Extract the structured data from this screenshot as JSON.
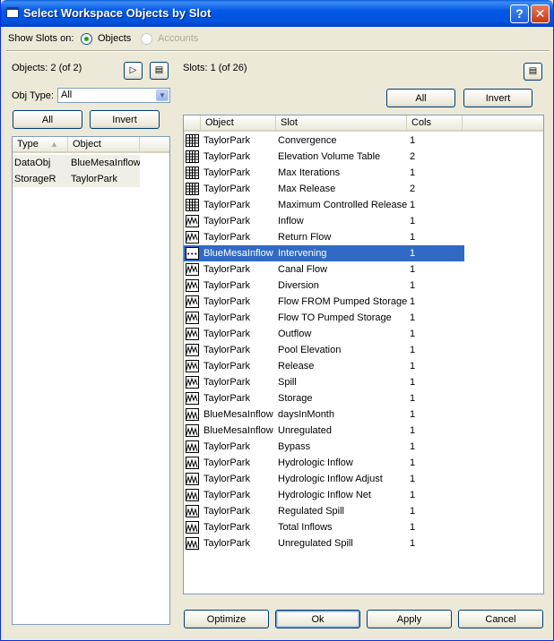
{
  "window": {
    "title": "Select Workspace Objects by Slot",
    "help_btn": "?",
    "close_btn": "✕"
  },
  "show_slots": {
    "label": "Show Slots on:",
    "options": [
      "Objects",
      "Accounts"
    ],
    "selected": "Objects"
  },
  "left": {
    "count_label": "Objects: 2 (of 2)",
    "play_icon": "▷",
    "config_icon": "▤",
    "obj_type_label": "Obj Type:",
    "obj_type_value": "All",
    "all_btn": "All",
    "invert_btn": "Invert",
    "columns": [
      "Type",
      "Object"
    ],
    "sort_indicator": "▲",
    "rows": [
      {
        "type": "DataObj",
        "object": "BlueMesaInflow"
      },
      {
        "type": "StorageR",
        "object": "TaylorPark"
      }
    ]
  },
  "right": {
    "count_label": "Slots: 1 (of 26)",
    "config_icon": "▤",
    "all_btn": "All",
    "invert_btn": "Invert",
    "columns": [
      "Object",
      "Slot",
      "Cols"
    ],
    "selected_index": 7,
    "rows": [
      {
        "icon": "table-icon",
        "object": "TaylorPark",
        "slot": "Convergence",
        "cols": "1"
      },
      {
        "icon": "table-icon",
        "object": "TaylorPark",
        "slot": "Elevation Volume Table",
        "cols": "2"
      },
      {
        "icon": "table-icon",
        "object": "TaylorPark",
        "slot": "Max Iterations",
        "cols": "1"
      },
      {
        "icon": "table-icon",
        "object": "TaylorPark",
        "slot": "Max Release",
        "cols": "2"
      },
      {
        "icon": "table-icon",
        "object": "TaylorPark",
        "slot": "Maximum Controlled Release",
        "cols": "1"
      },
      {
        "icon": "series-icon",
        "object": "TaylorPark",
        "slot": "Inflow",
        "cols": "1"
      },
      {
        "icon": "series-icon",
        "object": "TaylorPark",
        "slot": "Return Flow",
        "cols": "1"
      },
      {
        "icon": "scalar-icon",
        "object": "BlueMesaInflow",
        "slot": "Intervening",
        "cols": "1"
      },
      {
        "icon": "series-icon",
        "object": "TaylorPark",
        "slot": "Canal Flow",
        "cols": "1"
      },
      {
        "icon": "series-icon",
        "object": "TaylorPark",
        "slot": "Diversion",
        "cols": "1"
      },
      {
        "icon": "series-icon",
        "object": "TaylorPark",
        "slot": "Flow FROM Pumped Storage",
        "cols": "1"
      },
      {
        "icon": "series-icon",
        "object": "TaylorPark",
        "slot": "Flow TO Pumped Storage",
        "cols": "1"
      },
      {
        "icon": "series-icon",
        "object": "TaylorPark",
        "slot": "Outflow",
        "cols": "1"
      },
      {
        "icon": "series-icon",
        "object": "TaylorPark",
        "slot": "Pool Elevation",
        "cols": "1"
      },
      {
        "icon": "series-icon",
        "object": "TaylorPark",
        "slot": "Release",
        "cols": "1"
      },
      {
        "icon": "series-icon",
        "object": "TaylorPark",
        "slot": "Spill",
        "cols": "1"
      },
      {
        "icon": "series-icon",
        "object": "TaylorPark",
        "slot": "Storage",
        "cols": "1"
      },
      {
        "icon": "agg-series-icon",
        "object": "BlueMesaInflow",
        "slot": "daysInMonth",
        "cols": "1"
      },
      {
        "icon": "agg-series-icon",
        "object": "BlueMesaInflow",
        "slot": "Unregulated",
        "cols": "1"
      },
      {
        "icon": "agg-series-icon",
        "object": "TaylorPark",
        "slot": "Bypass",
        "cols": "1"
      },
      {
        "icon": "agg-series-icon",
        "object": "TaylorPark",
        "slot": "Hydrologic Inflow",
        "cols": "1"
      },
      {
        "icon": "agg-series-icon",
        "object": "TaylorPark",
        "slot": "Hydrologic Inflow Adjust",
        "cols": "1"
      },
      {
        "icon": "agg-series-icon",
        "object": "TaylorPark",
        "slot": "Hydrologic Inflow Net",
        "cols": "1"
      },
      {
        "icon": "agg-series-icon",
        "object": "TaylorPark",
        "slot": "Regulated Spill",
        "cols": "1"
      },
      {
        "icon": "agg-series-icon",
        "object": "TaylorPark",
        "slot": "Total Inflows",
        "cols": "1"
      },
      {
        "icon": "agg-series-icon",
        "object": "TaylorPark",
        "slot": "Unregulated Spill",
        "cols": "1"
      }
    ]
  },
  "footer": {
    "optimize": "Optimize",
    "ok": "Ok",
    "apply": "Apply",
    "cancel": "Cancel"
  }
}
